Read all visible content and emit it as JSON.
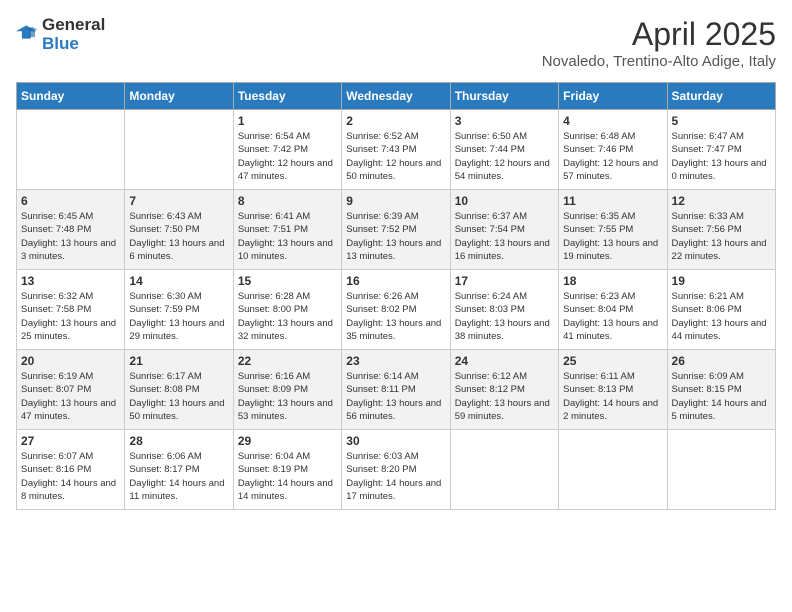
{
  "header": {
    "logo_general": "General",
    "logo_blue": "Blue",
    "title": "April 2025",
    "subtitle": "Novaledo, Trentino-Alto Adige, Italy"
  },
  "days_of_week": [
    "Sunday",
    "Monday",
    "Tuesday",
    "Wednesday",
    "Thursday",
    "Friday",
    "Saturday"
  ],
  "weeks": [
    [
      {
        "day": "",
        "info": ""
      },
      {
        "day": "",
        "info": ""
      },
      {
        "day": "1",
        "info": "Sunrise: 6:54 AM\nSunset: 7:42 PM\nDaylight: 12 hours and 47 minutes."
      },
      {
        "day": "2",
        "info": "Sunrise: 6:52 AM\nSunset: 7:43 PM\nDaylight: 12 hours and 50 minutes."
      },
      {
        "day": "3",
        "info": "Sunrise: 6:50 AM\nSunset: 7:44 PM\nDaylight: 12 hours and 54 minutes."
      },
      {
        "day": "4",
        "info": "Sunrise: 6:48 AM\nSunset: 7:46 PM\nDaylight: 12 hours and 57 minutes."
      },
      {
        "day": "5",
        "info": "Sunrise: 6:47 AM\nSunset: 7:47 PM\nDaylight: 13 hours and 0 minutes."
      }
    ],
    [
      {
        "day": "6",
        "info": "Sunrise: 6:45 AM\nSunset: 7:48 PM\nDaylight: 13 hours and 3 minutes."
      },
      {
        "day": "7",
        "info": "Sunrise: 6:43 AM\nSunset: 7:50 PM\nDaylight: 13 hours and 6 minutes."
      },
      {
        "day": "8",
        "info": "Sunrise: 6:41 AM\nSunset: 7:51 PM\nDaylight: 13 hours and 10 minutes."
      },
      {
        "day": "9",
        "info": "Sunrise: 6:39 AM\nSunset: 7:52 PM\nDaylight: 13 hours and 13 minutes."
      },
      {
        "day": "10",
        "info": "Sunrise: 6:37 AM\nSunset: 7:54 PM\nDaylight: 13 hours and 16 minutes."
      },
      {
        "day": "11",
        "info": "Sunrise: 6:35 AM\nSunset: 7:55 PM\nDaylight: 13 hours and 19 minutes."
      },
      {
        "day": "12",
        "info": "Sunrise: 6:33 AM\nSunset: 7:56 PM\nDaylight: 13 hours and 22 minutes."
      }
    ],
    [
      {
        "day": "13",
        "info": "Sunrise: 6:32 AM\nSunset: 7:58 PM\nDaylight: 13 hours and 25 minutes."
      },
      {
        "day": "14",
        "info": "Sunrise: 6:30 AM\nSunset: 7:59 PM\nDaylight: 13 hours and 29 minutes."
      },
      {
        "day": "15",
        "info": "Sunrise: 6:28 AM\nSunset: 8:00 PM\nDaylight: 13 hours and 32 minutes."
      },
      {
        "day": "16",
        "info": "Sunrise: 6:26 AM\nSunset: 8:02 PM\nDaylight: 13 hours and 35 minutes."
      },
      {
        "day": "17",
        "info": "Sunrise: 6:24 AM\nSunset: 8:03 PM\nDaylight: 13 hours and 38 minutes."
      },
      {
        "day": "18",
        "info": "Sunrise: 6:23 AM\nSunset: 8:04 PM\nDaylight: 13 hours and 41 minutes."
      },
      {
        "day": "19",
        "info": "Sunrise: 6:21 AM\nSunset: 8:06 PM\nDaylight: 13 hours and 44 minutes."
      }
    ],
    [
      {
        "day": "20",
        "info": "Sunrise: 6:19 AM\nSunset: 8:07 PM\nDaylight: 13 hours and 47 minutes."
      },
      {
        "day": "21",
        "info": "Sunrise: 6:17 AM\nSunset: 8:08 PM\nDaylight: 13 hours and 50 minutes."
      },
      {
        "day": "22",
        "info": "Sunrise: 6:16 AM\nSunset: 8:09 PM\nDaylight: 13 hours and 53 minutes."
      },
      {
        "day": "23",
        "info": "Sunrise: 6:14 AM\nSunset: 8:11 PM\nDaylight: 13 hours and 56 minutes."
      },
      {
        "day": "24",
        "info": "Sunrise: 6:12 AM\nSunset: 8:12 PM\nDaylight: 13 hours and 59 minutes."
      },
      {
        "day": "25",
        "info": "Sunrise: 6:11 AM\nSunset: 8:13 PM\nDaylight: 14 hours and 2 minutes."
      },
      {
        "day": "26",
        "info": "Sunrise: 6:09 AM\nSunset: 8:15 PM\nDaylight: 14 hours and 5 minutes."
      }
    ],
    [
      {
        "day": "27",
        "info": "Sunrise: 6:07 AM\nSunset: 8:16 PM\nDaylight: 14 hours and 8 minutes."
      },
      {
        "day": "28",
        "info": "Sunrise: 6:06 AM\nSunset: 8:17 PM\nDaylight: 14 hours and 11 minutes."
      },
      {
        "day": "29",
        "info": "Sunrise: 6:04 AM\nSunset: 8:19 PM\nDaylight: 14 hours and 14 minutes."
      },
      {
        "day": "30",
        "info": "Sunrise: 6:03 AM\nSunset: 8:20 PM\nDaylight: 14 hours and 17 minutes."
      },
      {
        "day": "",
        "info": ""
      },
      {
        "day": "",
        "info": ""
      },
      {
        "day": "",
        "info": ""
      }
    ]
  ]
}
